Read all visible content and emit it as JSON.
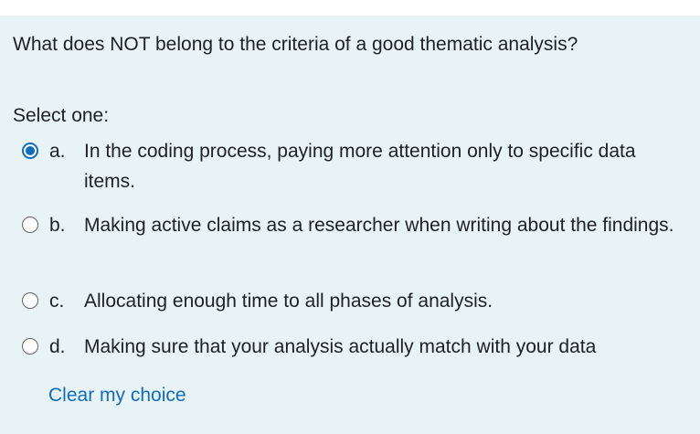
{
  "question": {
    "text": "What does NOT belong to the criteria of a good thematic analysis?",
    "prompt": "Select one:"
  },
  "options": [
    {
      "letter": "a.",
      "text": "In the coding process, paying more attention only to specific data items.",
      "selected": true
    },
    {
      "letter": "b.",
      "text": "Making active claims as a researcher when writing about the findings.",
      "selected": false
    },
    {
      "letter": "c.",
      "text": "Allocating enough time to all phases of analysis.",
      "selected": false
    },
    {
      "letter": "d.",
      "text": "Making sure that your analysis actually match with your data",
      "selected": false
    }
  ],
  "clear_label": "Clear my choice",
  "colors": {
    "panel": "#e7f3f5",
    "accent": "#0f6cbf",
    "text": "#1d2125"
  }
}
